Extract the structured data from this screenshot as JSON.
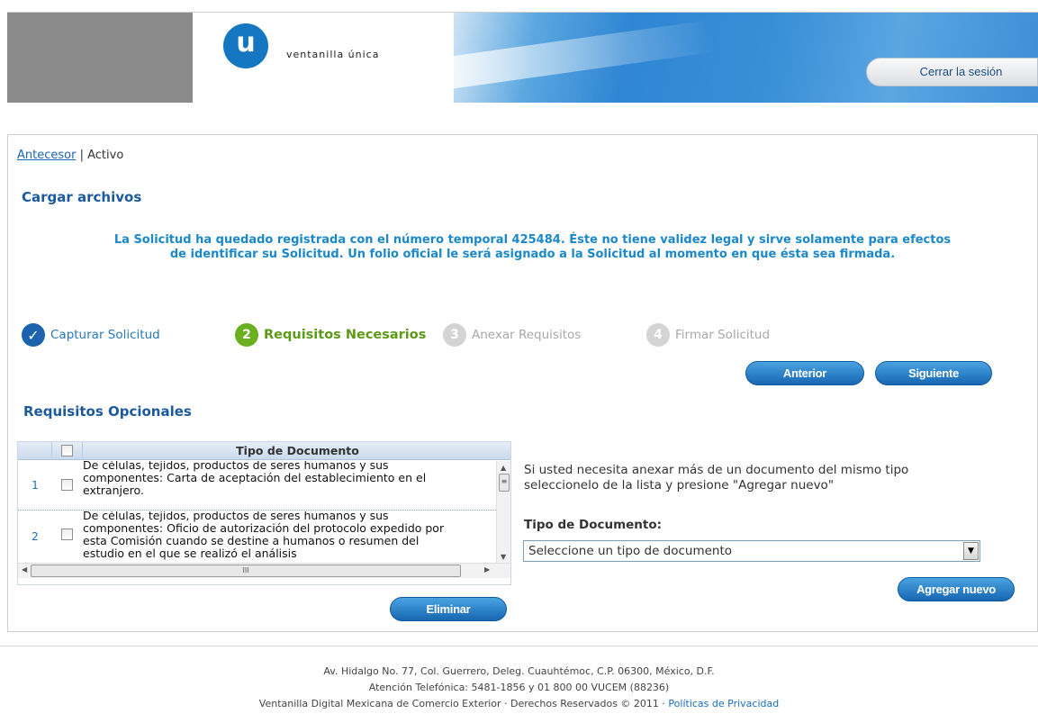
{
  "header": {
    "logo_letter": "u",
    "logo_text": "ventanilla única",
    "logout_label": "Cerrar la sesión"
  },
  "breadcrumb": {
    "link": "Antecesor",
    "separator": "|",
    "current": "Activo"
  },
  "page": {
    "title": "Cargar archivos",
    "notice_line1": "La Solicitud ha quedado registrada con el número temporal 425484. Éste no tiene validez legal y sirve solamente para efectos",
    "notice_line2": "de identificar su Solicitud. Un folio oficial le será asignado a la Solicitud al momento en que ésta sea firmada."
  },
  "steps": [
    {
      "marker": "✓",
      "label": "Capturar Solicitud",
      "state": "done"
    },
    {
      "marker": "2",
      "label": "Requisitos Necesarios",
      "state": "active"
    },
    {
      "marker": "3",
      "label": "Anexar Requisitos",
      "state": "pending"
    },
    {
      "marker": "4",
      "label": "Firmar Solicitud",
      "state": "pending"
    }
  ],
  "nav": {
    "prev_label": "Anterior",
    "next_label": "Siguiente"
  },
  "optional": {
    "title": "Requisitos Opcionales",
    "column_header": "Tipo de Documento",
    "rows": [
      {
        "num": "1",
        "lines": [
          "De células, tejidos, productos de seres humanos y sus",
          "componentes: Carta de aceptación del establecimiento en el",
          "extranjero."
        ]
      },
      {
        "num": "2",
        "lines": [
          "De células, tejidos, productos de seres humanos y sus",
          "componentes: Oficio de autorización del protocolo expedido por",
          "esta Comisión cuando se destine a humanos o resumen del",
          "estudio en el que se realizó el análisis"
        ]
      }
    ],
    "delete_label": "Eliminar",
    "help_line1": "Si usted necesita anexar más de un documento del mismo tipo",
    "help_line2": "seleccionelo de la lista y presione \"Agregar nuevo\"",
    "field_label": "Tipo de Documento:",
    "select_value": "Seleccione un tipo de documento",
    "add_label": "Agregar nuevo"
  },
  "footer": {
    "line1": "Av. Hidalgo No. 77, Col. Guerrero, Deleg. Cuauhtémoc, C.P. 06300, México, D.F.",
    "line2": "Atención Telefónica: 5481-1856 y 01 800 00 VUCEM (88236)",
    "line3": "Ventanilla Digital Mexicana de Comercio Exterior · Derechos Reservados © 2011 ·",
    "privacy": "Políticas de Privacidad"
  },
  "colors": {
    "brand_blue": "#1577c2",
    "title_blue": "#1b5a9c",
    "notice_blue": "#1a88c9",
    "active_step_green": "#6aaf1f"
  }
}
